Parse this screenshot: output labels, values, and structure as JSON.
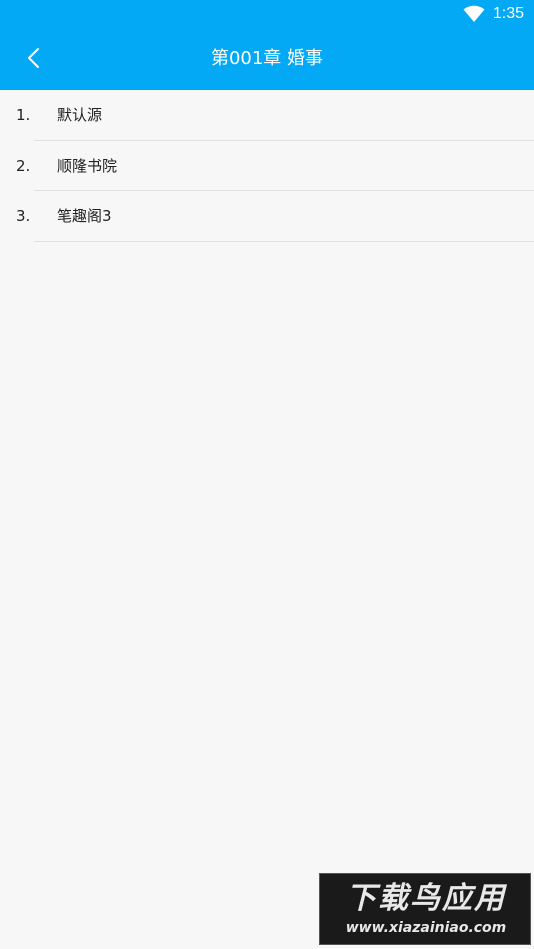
{
  "status_bar": {
    "time": "1:35",
    "wifi_icon": "wifi-icon"
  },
  "toolbar": {
    "title": "第001章 婚事",
    "back_icon": "chevron-left-icon"
  },
  "sources": [
    {
      "index": "1.",
      "label": "默认源"
    },
    {
      "index": "2.",
      "label": "顺隆书院"
    },
    {
      "index": "3.",
      "label": "笔趣阁3"
    }
  ],
  "watermark": {
    "title": "下载鸟应用",
    "url": "www.xiazainiao.com"
  },
  "colors": {
    "accent": "#03a9f4",
    "background": "#f7f7f7",
    "divider": "#e0e0e0"
  }
}
